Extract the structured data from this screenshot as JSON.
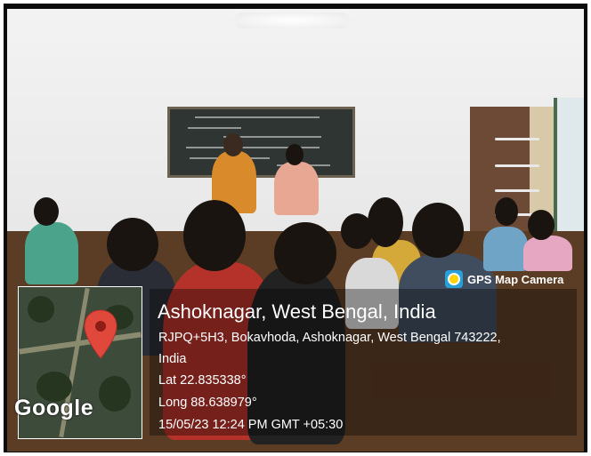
{
  "badge": {
    "label": "GPS Map Camera",
    "icon": "gps-map-camera-icon"
  },
  "location": {
    "title": "Ashoknagar, West Bengal, India",
    "address_line1": "RJPQ+5H3, Bokavhoda, Ashoknagar, West Bengal 743222,",
    "address_line2": "India",
    "lat": "Lat 22.835338°",
    "long": "Long 88.638979°",
    "datetime": "15/05/23 12:24 PM GMT +05:30"
  },
  "map": {
    "watermark": "Google",
    "pin_color": "#e0483c"
  }
}
